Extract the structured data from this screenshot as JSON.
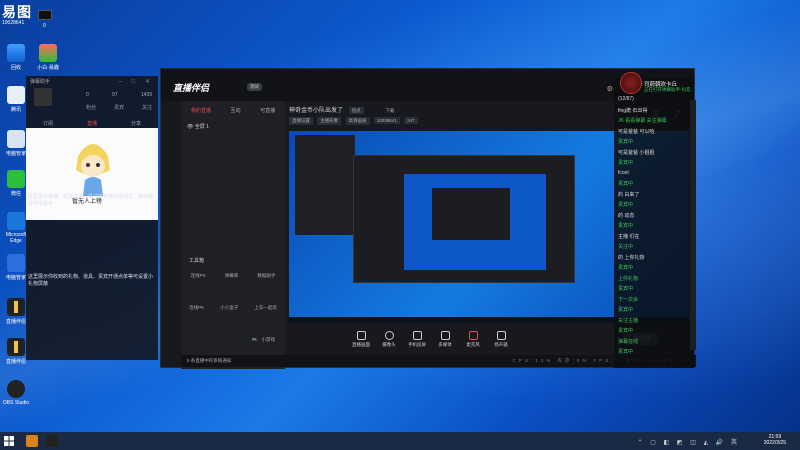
{
  "desktop": {
    "top_logo": "易图",
    "top_id": "10028641",
    "top_count": "0",
    "icons": [
      {
        "label": "回收"
      },
      {
        "label": "小白·易趣"
      },
      {
        "label": "腾讯"
      },
      {
        "label": "电脑管家"
      },
      {
        "label": "微信"
      },
      {
        "label": "Microsoft Edge"
      },
      {
        "label": "电脑管家"
      },
      {
        "label": "直播伴侣"
      },
      {
        "label": "直播伴侣"
      },
      {
        "label": "OBS Studio"
      }
    ]
  },
  "left_panel": {
    "title": "弹幕助手",
    "stats": [
      "0",
      "97",
      "1439"
    ],
    "sub_tabs": [
      "粉丝",
      "贵宾",
      "关注"
    ],
    "tabs": [
      "订阅",
      "直播",
      "分享"
    ],
    "mascot_caption": "暂无人上榜",
    "messages": [
      "这里展示弹幕、贵宾进场、关注等开播互动消息，添加弹幕助手提示",
      "这里展示你收到的礼物、道具、贵宾开通点单等可设置小礼物屏蔽"
    ]
  },
  "right_panel": {
    "title": "司蔚朝欢卡丘",
    "subtitle": "正在打开弹幕助手·抖音",
    "lines": [
      {
        "user": "(12/87)",
        "text": ""
      },
      {
        "user": "fing爬",
        "text": "石出得"
      },
      {
        "user": "",
        "text": "JK 看看弹幕 关注弹幕"
      },
      {
        "user": "可是爸爸",
        "text": "可以哈"
      },
      {
        "user": "",
        "text": "贵宾中"
      },
      {
        "user": "可是爸爸",
        "text": "小姐姐"
      },
      {
        "user": "",
        "text": "贵宾中"
      },
      {
        "user": "fcool",
        "text": ""
      },
      {
        "user": "",
        "text": "贵宾中"
      },
      {
        "user": "的",
        "text": "白来了"
      },
      {
        "user": "",
        "text": "贵宾中"
      },
      {
        "user": "的",
        "text": "动态"
      },
      {
        "user": "",
        "text": "贵宾中"
      },
      {
        "user": "主播",
        "text": "们在"
      },
      {
        "user": "",
        "text": "关注中"
      },
      {
        "user": "的",
        "text": "上你礼物"
      },
      {
        "user": "",
        "text": "贵宾中"
      },
      {
        "user": "",
        "text": "上你礼物"
      },
      {
        "user": "",
        "text": "贵宾中"
      },
      {
        "user": "",
        "text": "下一次会"
      },
      {
        "user": "",
        "text": "贵宾中"
      },
      {
        "user": "",
        "text": "关注主播"
      },
      {
        "user": "",
        "text": "贵宾中"
      },
      {
        "user": "",
        "text": "弹幕在线"
      },
      {
        "user": "",
        "text": "贵宾中"
      }
    ]
  },
  "main_window": {
    "app_name": "直播伴侣",
    "badge": "测试",
    "side_tabs": [
      "我的直播",
      "互动",
      "可直播"
    ],
    "scene_label": "全屏 1",
    "tools_label": "工具箱",
    "tool_rows": [
      [
        "连线PK",
        "弹幕库",
        "数据助手"
      ],
      [
        "连线PK",
        "小小盒子",
        "上车一起玩"
      ],
      [
        "",
        "",
        "小游戏"
      ]
    ],
    "bottom_tool": "主播一起玩",
    "footer_note": "5 条直播中的系统通知",
    "footer_stats": "CPU:13% 内存:0% FPS:0 丢帧:0% 码率:0",
    "header_title": "神奇金币小队出发了",
    "header_tag": "热点",
    "header_sub": "下载",
    "header_pills": [
      "直播设置",
      "主播形象",
      "高清画质",
      "10028641",
      "247"
    ],
    "controls": [
      "直播画面",
      "摄像头",
      "手机投屏",
      "多媒体",
      "麦克风",
      "扬声器"
    ],
    "start_button": "开始直播"
  },
  "taskbar": {
    "time": "21:59",
    "date": "2022/3/25"
  }
}
